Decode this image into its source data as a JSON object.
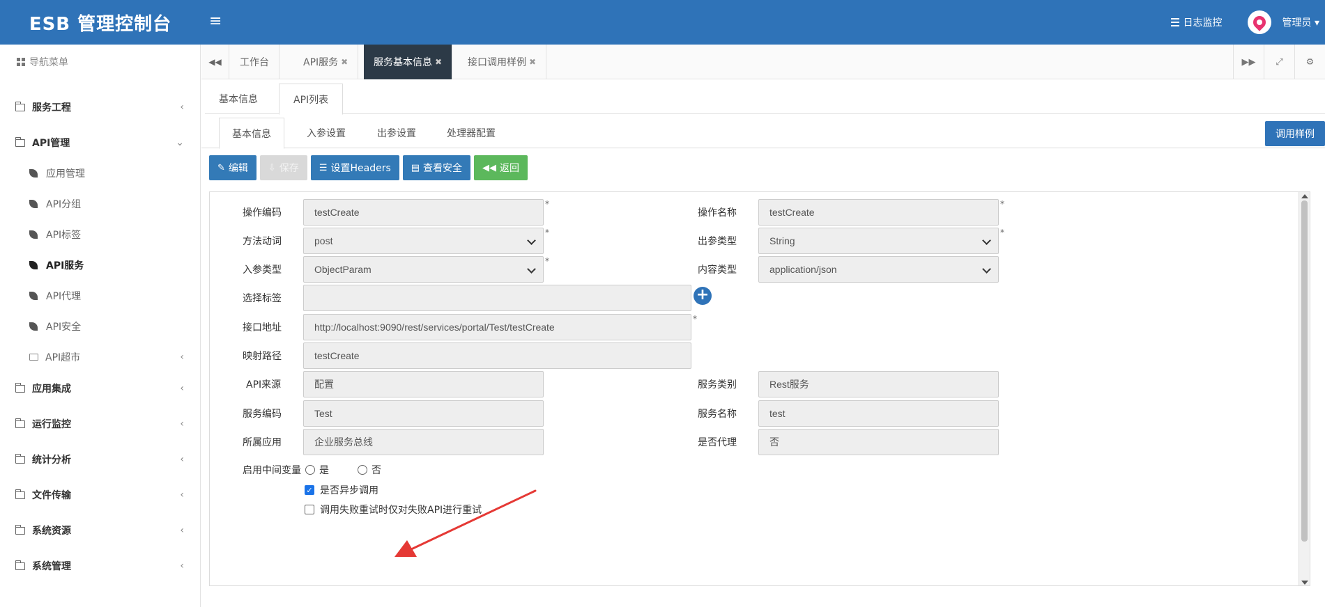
{
  "header": {
    "brand": "ESB 管理控制台",
    "menu_toggle": "≡",
    "log_monitor": "日志监控",
    "user_name": "管理员 ▾"
  },
  "sidebar": {
    "nav_title": "导航菜单",
    "items": [
      {
        "label": "服务工程",
        "chevron": "‹"
      },
      {
        "label": "API管理",
        "chevron": "⌄"
      },
      {
        "label": "应用集成",
        "chevron": "‹"
      },
      {
        "label": "运行监控",
        "chevron": "‹"
      },
      {
        "label": "统计分析",
        "chevron": "‹"
      },
      {
        "label": "文件传输",
        "chevron": "‹"
      },
      {
        "label": "系统资源",
        "chevron": "‹"
      },
      {
        "label": "系统管理",
        "chevron": "‹"
      }
    ],
    "api_sub_items": [
      {
        "label": "应用管理"
      },
      {
        "label": "API分组"
      },
      {
        "label": "API标签"
      },
      {
        "label": "API服务",
        "active": true
      },
      {
        "label": "API代理"
      },
      {
        "label": "API安全"
      },
      {
        "label": "API超市",
        "chevron": "‹"
      }
    ]
  },
  "page_tabs": [
    {
      "label": "工作台",
      "closable": false
    },
    {
      "label": "API服务",
      "closable": true
    },
    {
      "label": "服务基本信息",
      "closable": true,
      "active": true
    },
    {
      "label": "接口调用样例",
      "closable": true
    }
  ],
  "page_tab_close": "✖",
  "tabs_level1": [
    {
      "label": "基本信息"
    },
    {
      "label": "API列表",
      "active": true
    }
  ],
  "tabs_level2": [
    {
      "label": "基本信息",
      "active": true
    },
    {
      "label": "入参设置"
    },
    {
      "label": "出参设置"
    },
    {
      "label": "处理器配置"
    }
  ],
  "sample_button": "调用样例",
  "toolbar": {
    "edit": "编辑",
    "save": "保存",
    "headers": "设置Headers",
    "security": "查看安全",
    "back": "返回"
  },
  "form": {
    "op_code_label": "操作编码",
    "op_code_value": "testCreate",
    "op_name_label": "操作名称",
    "op_name_value": "testCreate",
    "method_label": "方法动词",
    "method_value": "post",
    "out_type_label": "出参类型",
    "out_type_value": "String",
    "in_type_label": "入参类型",
    "in_type_value": "ObjectParam",
    "content_type_label": "内容类型",
    "content_type_value": "application/json",
    "tags_label": "选择标签",
    "tags_value": "",
    "url_label": "接口地址",
    "url_value": "http://localhost:9090/rest/services/portal/Test/testCreate",
    "map_path_label": "映射路径",
    "map_path_value": "testCreate",
    "api_source_label": "API来源",
    "api_source_value": "配置",
    "service_type_label": "服务类别",
    "service_type_value": "Rest服务",
    "service_code_label": "服务编码",
    "service_code_value": "Test",
    "service_name_label": "服务名称",
    "service_name_value": "test",
    "app_label": "所属应用",
    "app_value": "企业服务总线",
    "proxy_label": "是否代理",
    "proxy_value": "否",
    "mid_var_label": "启用中间变量",
    "radio_yes": "是",
    "radio_no": "否",
    "async_label": "是否异步调用",
    "async_checked": true,
    "retry_label": "调用失败重试时仅对失败API进行重试",
    "retry_checked": false,
    "required_mark": "*"
  },
  "colors": {
    "header_bg": "#2f73b8",
    "active_tab_bg": "#2c3a47",
    "primary_btn": "#337ab7",
    "success_btn": "#5cb85c",
    "annotation_arrow": "#e53935"
  }
}
